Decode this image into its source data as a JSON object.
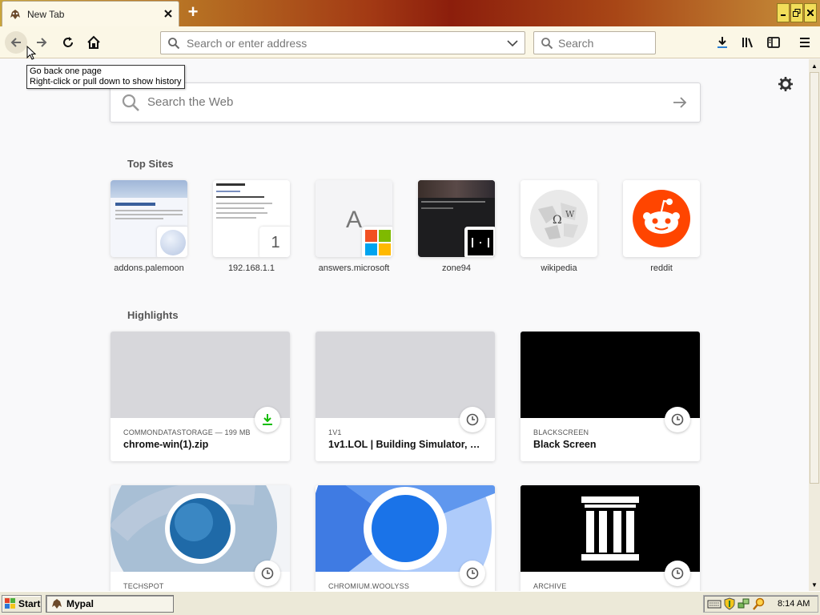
{
  "window": {
    "tab_title": "New Tab",
    "tab_icon": "mypal-icon",
    "new_tab_label": "+",
    "controls": [
      "minimize",
      "restore",
      "close"
    ]
  },
  "toolbar": {
    "url_placeholder": "Search or enter address",
    "search_placeholder": "Search"
  },
  "tooltip": {
    "line1": "Go back one page",
    "line2": "Right-click or pull down to show history"
  },
  "newtab": {
    "web_search_placeholder": "Search the Web",
    "top_sites_title": "Top Sites",
    "top_sites": [
      {
        "label": "addons.palemoon"
      },
      {
        "label": "192.168.1.1",
        "badge": "1"
      },
      {
        "label": "answers.microsoft",
        "letter": "A"
      },
      {
        "label": "zone94"
      },
      {
        "label": "wikipedia"
      },
      {
        "label": "reddit"
      }
    ],
    "highlights_title": "Highlights",
    "highlights": [
      {
        "host": "COMMONDATASTORAGE — 199 MB",
        "title": "chrome-win(1).zip",
        "icon": "download-icon"
      },
      {
        "host": "1V1",
        "title": "1v1.LOL | Building Simulator, Ba...",
        "icon": "clock-icon"
      },
      {
        "host": "BLACKSCREEN",
        "title": "Black Screen",
        "icon": "clock-icon"
      },
      {
        "host": "TECHSPOT",
        "icon": "clock-icon"
      },
      {
        "host": "CHROMIUM.WOOLYSS",
        "icon": "clock-icon"
      },
      {
        "host": "ARCHIVE",
        "icon": "clock-icon"
      }
    ]
  },
  "taskbar": {
    "start_label": "Start",
    "task_label": "Mypal",
    "clock": "8:14 AM"
  },
  "colors": {
    "accent_download": "#12bc00",
    "reddit": "#ff4500",
    "highlight_placeholder": "#d7d7db"
  }
}
